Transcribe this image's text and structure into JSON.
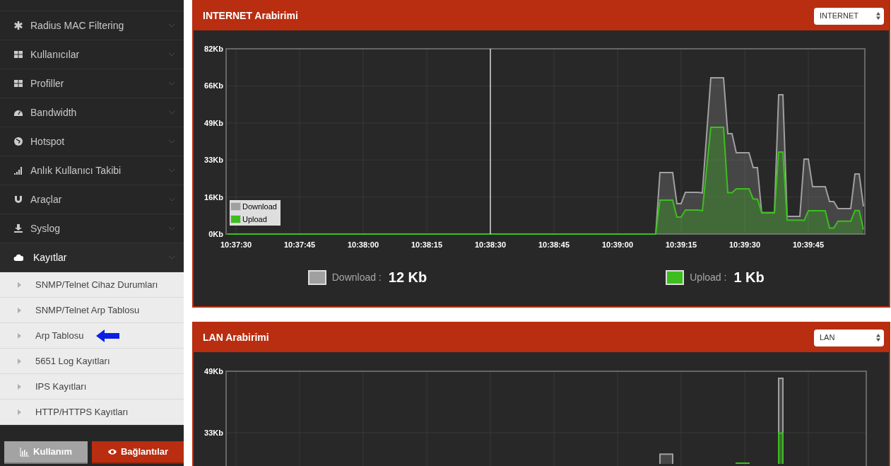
{
  "sidebar": {
    "items": [
      {
        "label": "Radius MAC Filtering",
        "expanded": false
      },
      {
        "label": "Kullanıcılar",
        "expanded": false
      },
      {
        "label": "Profiller",
        "expanded": false
      },
      {
        "label": "Bandwidth",
        "expanded": false
      },
      {
        "label": "Hotspot",
        "expanded": false
      },
      {
        "label": "Anlık Kullanıcı Takibi",
        "expanded": false
      },
      {
        "label": "Araçlar",
        "expanded": false
      },
      {
        "label": "Syslog",
        "expanded": false
      },
      {
        "label": "Kayıtlar",
        "expanded": true,
        "children": [
          {
            "label": "SNMP/Telnet Cihaz Durumları",
            "marked": false
          },
          {
            "label": "SNMP/Telnet Arp Tablosu",
            "marked": false
          },
          {
            "label": "Arp Tablosu",
            "marked": true
          },
          {
            "label": "5651 Log Kayıtları",
            "marked": false
          },
          {
            "label": "IPS Kayıtları",
            "marked": false
          },
          {
            "label": "HTTP/HTTPS Kayıtları",
            "marked": false
          }
        ]
      }
    ],
    "footer_buttons": [
      {
        "label": "Kullanım",
        "selected": false
      },
      {
        "label": "Bağlantılar",
        "selected": true
      }
    ]
  },
  "panels": [
    {
      "title": "INTERNET Arabirimi",
      "select": "INTERNET",
      "chart_data": {
        "type": "area",
        "ylim": [
          0,
          82
        ],
        "categories": [
          null,
          null,
          "10:37:30",
          null,
          null,
          null,
          null,
          null,
          null,
          null,
          null,
          null,
          null,
          null,
          null,
          null,
          null,
          "10:37:45",
          null,
          null,
          null,
          null,
          null,
          null,
          null,
          null,
          null,
          null,
          null,
          null,
          null,
          null,
          "10:38:00",
          null,
          null,
          null,
          null,
          null,
          null,
          null,
          null,
          null,
          null,
          null,
          null,
          null,
          null,
          "10:38:15",
          null,
          null,
          null,
          null,
          null,
          null,
          null,
          null,
          null,
          null,
          null,
          null,
          null,
          null,
          "10:38:30",
          null,
          null,
          null,
          null,
          null,
          null,
          null,
          null,
          null,
          null,
          null,
          null,
          null,
          null,
          "10:38:45",
          null,
          null,
          null,
          null,
          null,
          null,
          null,
          null,
          null,
          null,
          null,
          null,
          null,
          null,
          "10:39:00",
          null,
          null,
          null,
          null,
          null,
          null,
          null,
          null,
          null,
          null,
          null,
          null,
          null,
          null,
          "10:39:15",
          null,
          null,
          null,
          null,
          null,
          null,
          null,
          null,
          null,
          null,
          null,
          null,
          null,
          null,
          "10:39:30",
          null,
          null,
          null,
          null,
          null,
          null,
          null,
          null,
          null,
          null,
          null,
          null,
          null,
          null,
          "10:39:45",
          null,
          null,
          null,
          null,
          null,
          null,
          null,
          null,
          null,
          null,
          null,
          null,
          null
        ],
        "yticks": [
          {
            "value": 0,
            "label": "0Kb"
          },
          {
            "value": 16.4,
            "label": "16Kb"
          },
          {
            "value": 32.8,
            "label": "33Kb"
          },
          {
            "value": 49.2,
            "label": "49Kb"
          },
          {
            "value": 65.6,
            "label": "66Kb"
          },
          {
            "value": 82,
            "label": "82Kb"
          }
        ],
        "series": [
          {
            "name": "Download",
            "color": "#a0a0a0",
            "values": [
              0,
              0,
              0,
              0,
              0,
              0,
              0,
              0,
              0,
              0,
              0,
              0,
              0,
              0,
              0,
              0,
              0,
              0,
              0,
              0,
              0,
              0,
              0,
              0,
              0,
              0,
              0,
              0,
              0,
              0,
              0,
              0,
              0,
              0,
              0,
              0,
              0,
              0,
              0,
              0,
              0,
              0,
              0,
              0,
              0,
              0,
              0,
              0,
              0,
              0,
              0,
              0,
              0,
              0,
              0,
              0,
              0,
              0,
              0,
              0,
              0,
              0,
              0,
              0,
              0,
              0,
              0,
              0,
              0,
              0,
              0,
              0,
              0,
              0,
              0,
              0,
              0,
              0,
              0,
              0,
              0,
              0,
              0,
              0,
              0,
              0,
              0,
              0,
              0,
              0,
              0,
              0,
              0,
              0,
              0,
              0,
              0,
              0,
              0,
              0,
              0,
              0,
              27.2,
              27.2,
              27.2,
              27.2,
              13.5,
              13.5,
              18.5,
              18.5,
              18.5,
              18.5,
              18.2,
              43.7,
              69.2,
              69.2,
              69.2,
              69.2,
              44.4,
              44.4,
              36,
              36,
              36,
              36,
              29.4,
              29.4,
              9.4,
              9.4,
              9.4,
              9.4,
              61.7,
              61.7,
              7.8,
              7.8,
              7.8,
              7.8,
              33.2,
              33.2,
              21,
              21,
              21,
              21,
              14.4,
              14.4,
              11.3,
              11.3,
              11.3,
              11.3,
              26.6,
              26.6,
              12.2
            ]
          },
          {
            "name": "Upload",
            "color": "#3cbf1e",
            "values": [
              0,
              0,
              0,
              0,
              0,
              0,
              0,
              0,
              0,
              0,
              0,
              0,
              0,
              0,
              0,
              0,
              0,
              0,
              0,
              0,
              0,
              0,
              0,
              0,
              0,
              0,
              0,
              0,
              0,
              0,
              0,
              0,
              0,
              0,
              0,
              0,
              0,
              0,
              0,
              0,
              0,
              0,
              0,
              0,
              0,
              0,
              0,
              0,
              0,
              0,
              0,
              0,
              0,
              0,
              0,
              0,
              0,
              0,
              0,
              0,
              0,
              0,
              0,
              0,
              0,
              0,
              0,
              0,
              0,
              0,
              0,
              0,
              0,
              0,
              0,
              0,
              0,
              0,
              0,
              0,
              0,
              0,
              0,
              0,
              0,
              0,
              0,
              0,
              0,
              0,
              0,
              0,
              0,
              0,
              0,
              0,
              0,
              0,
              0,
              0,
              0,
              0,
              15,
              15,
              15,
              15,
              7.5,
              7.5,
              10.6,
              10.6,
              10.6,
              10.6,
              10.3,
              28.8,
              47.3,
              47.3,
              47.3,
              47.3,
              18.3,
              18.3,
              20,
              20,
              20,
              20,
              15.5,
              15.5,
              9.5,
              9.5,
              9.5,
              9.5,
              36.3,
              36.3,
              6.2,
              6.2,
              6.2,
              6.2,
              6,
              10.3,
              10.3,
              10.3,
              10.3,
              10.3,
              2.7,
              2.7,
              5.7,
              5.7,
              5.7,
              5.7,
              10.4,
              10.4,
              2
            ]
          }
        ],
        "ref_lines": [
          {
            "axis": "x",
            "value": "10:38:30"
          }
        ],
        "grid": true
      },
      "totals": [
        {
          "label": "Download :",
          "value": "12 Kb"
        },
        {
          "label": "Upload :",
          "value": "1 Kb"
        }
      ]
    },
    {
      "title": "LAN Arabirimi",
      "select": "LAN",
      "chart_data": {
        "type": "area",
        "grid": true,
        "ylim": [
          0,
          49.2
        ],
        "yticks": [
          {
            "value": 32.8,
            "label": "33Kb"
          },
          {
            "value": 49.2,
            "label": "49Kb"
          }
        ],
        "series": [
          {
            "color": "#a0a0a0",
            "values": [
              null,
              null,
              null,
              null,
              null,
              null,
              null,
              null,
              null,
              null,
              null,
              null,
              null,
              null,
              null,
              null,
              null,
              null,
              null,
              null,
              null,
              null,
              null,
              null,
              null,
              null,
              null,
              null,
              null,
              null,
              null,
              null,
              null,
              null,
              null,
              null,
              null,
              null,
              null,
              null,
              null,
              null,
              null,
              null,
              null,
              null,
              null,
              null,
              null,
              null,
              null,
              null,
              null,
              null,
              null,
              null,
              null,
              null,
              null,
              null,
              null,
              null,
              null,
              null,
              null,
              null,
              null,
              null,
              null,
              null,
              null,
              null,
              null,
              null,
              null,
              null,
              null,
              null,
              null,
              null,
              null,
              null,
              null,
              null,
              null,
              null,
              null,
              null,
              null,
              null,
              null,
              null,
              null,
              null,
              null,
              null,
              null,
              null,
              null,
              null,
              null,
              null,
              27.1,
              27.1,
              27.1,
              27.1,
              null,
              null,
              null,
              null,
              null,
              null,
              null,
              null,
              null,
              null,
              null,
              null,
              null,
              null,
              null,
              null,
              null,
              null,
              null,
              null,
              null,
              null,
              null,
              null,
              47.3,
              47.3,
              null,
              null,
              null,
              null,
              null,
              null,
              null,
              null,
              null,
              null,
              null,
              null,
              null,
              null,
              null,
              null,
              null,
              null,
              null
            ]
          },
          {
            "color": "#3cbf1e",
            "values": [
              null,
              null,
              null,
              null,
              null,
              null,
              null,
              null,
              null,
              null,
              null,
              null,
              null,
              null,
              null,
              null,
              null,
              null,
              null,
              null,
              null,
              null,
              null,
              null,
              null,
              null,
              null,
              null,
              null,
              null,
              null,
              null,
              null,
              null,
              null,
              null,
              null,
              null,
              null,
              null,
              null,
              null,
              null,
              null,
              null,
              null,
              null,
              null,
              null,
              null,
              null,
              null,
              null,
              null,
              null,
              null,
              null,
              null,
              null,
              null,
              null,
              null,
              null,
              null,
              null,
              null,
              null,
              null,
              null,
              null,
              null,
              null,
              null,
              null,
              null,
              null,
              null,
              null,
              null,
              null,
              null,
              null,
              null,
              null,
              null,
              null,
              null,
              null,
              null,
              null,
              null,
              null,
              null,
              null,
              null,
              null,
              null,
              null,
              null,
              null,
              null,
              null,
              null,
              null,
              null,
              null,
              null,
              null,
              null,
              null,
              null,
              null,
              null,
              null,
              null,
              null,
              null,
              null,
              null,
              null,
              24.7,
              24.7,
              24.7,
              24.7,
              null,
              null,
              null,
              null,
              null,
              null,
              32.7,
              32.7,
              null,
              null,
              null,
              null,
              null,
              null,
              null,
              null,
              null,
              null,
              null,
              null,
              null,
              null,
              null,
              null,
              null,
              null,
              null
            ]
          }
        ]
      }
    }
  ]
}
